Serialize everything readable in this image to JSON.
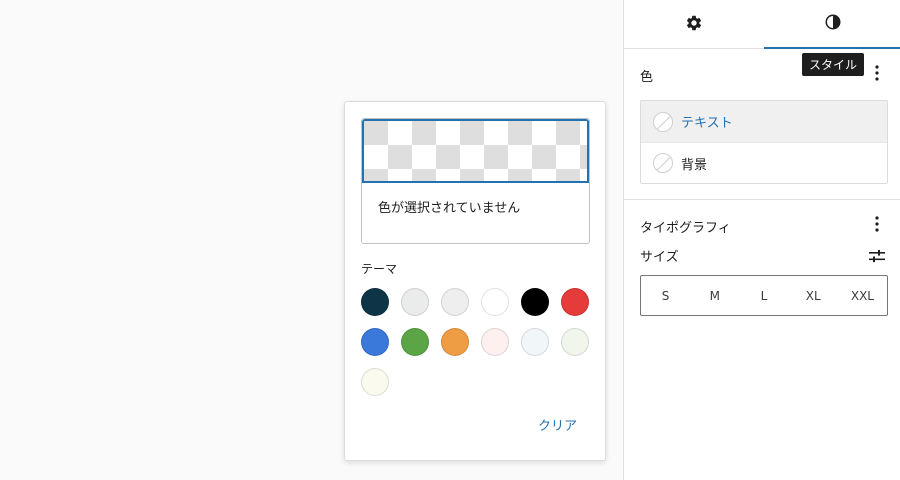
{
  "color_popover": {
    "preview_text": "色が選択されていません",
    "section_label": "テーマ",
    "palette": [
      "#0d3447",
      "#e9ecea",
      "#eeeeee",
      "#ffffff",
      "#000000",
      "#e53b3b",
      "#3a78d9",
      "#5ba547",
      "#ee9d45",
      "#fdf0ef",
      "#f1f6f9",
      "#f0f6ec",
      "#fafbee"
    ],
    "clear_label": "クリア"
  },
  "sidebar": {
    "tabs": [
      {
        "name": "settings",
        "icon": "gear-icon"
      },
      {
        "name": "styles",
        "icon": "half-circle-icon",
        "active": true
      }
    ],
    "tooltip": "スタイル",
    "color_section": {
      "title": "色",
      "items": [
        {
          "label": "テキスト",
          "active": true
        },
        {
          "label": "背景",
          "active": false
        }
      ]
    },
    "typography_section": {
      "title": "タイポグラフィ",
      "size_label": "サイズ",
      "sizes": [
        "S",
        "M",
        "L",
        "XL",
        "XXL"
      ]
    }
  },
  "colors": {
    "accent": "#2271b1",
    "text": "#1e1e1e"
  }
}
